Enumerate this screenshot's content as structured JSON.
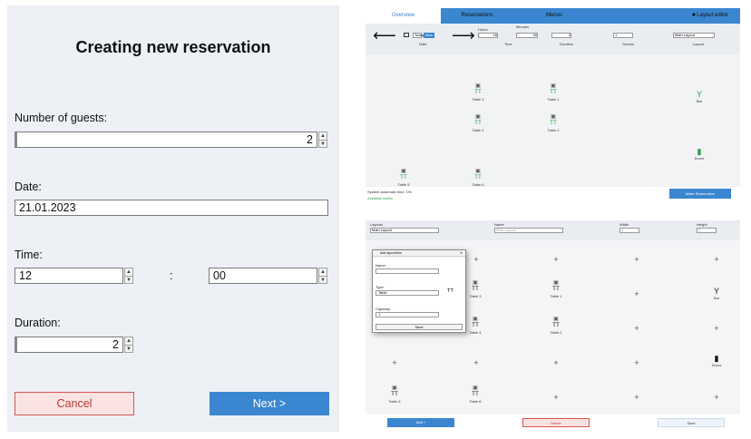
{
  "form": {
    "title": "Creating new reservation",
    "guests_label": "Number of guests:",
    "guests_value": "2",
    "date_label": "Date:",
    "date_value": "21.01.2023",
    "time_label": "Time:",
    "hours_value": "12",
    "time_separator": ":",
    "minutes_value": "00",
    "duration_label": "Duration:",
    "duration_value": "2",
    "cancel_label": "Cancel",
    "next_label": "Next >"
  },
  "overview": {
    "tabs": [
      "Overview",
      "Reservations",
      "Menus"
    ],
    "layout_editor_label": "Layout editor",
    "date_label": "Date",
    "today_label": "Today",
    "now_label": "Now",
    "hours_label": "Hours",
    "minutes_label": "Minutes",
    "hours_value": "16",
    "minutes_value": "30",
    "time_label": "Time",
    "duration_label": "Duration",
    "duration_value": "2",
    "guests_label": "Guests",
    "guests_value": "1",
    "layout_label": "Layout",
    "layout_value": "Main Layout",
    "tables": [
      {
        "name": "Table 3",
        "icon": "fork-knife-icon"
      },
      {
        "name": "Table 1",
        "icon": "fork-knife-icon"
      },
      {
        "name": "Bar",
        "icon": "cocktail-icon"
      },
      {
        "name": "Table 4",
        "icon": "fork-knife-icon"
      },
      {
        "name": "Table 2",
        "icon": "fork-knife-icon"
      },
      {
        "name": "Doors",
        "icon": "door-icon"
      },
      {
        "name": "Table 5",
        "icon": "fork-knife-icon"
      },
      {
        "name": "Table 6",
        "icon": "fork-knife-icon"
      }
    ],
    "status_line1": "System automatic time: ON",
    "status_line2": "Available tables",
    "make_reservation_label": "Make Reservation"
  },
  "editor": {
    "layouts_label": "Layouts",
    "layouts_value": "Main Layout",
    "name_label": "Name",
    "name_placeholder": "Main Layout",
    "width_label": "Width",
    "width_value": "5",
    "height_label": "Height",
    "height_value": "5",
    "plus": "+",
    "cells": [
      {
        "name": "Table 3",
        "icon": "fork-knife-icon"
      },
      {
        "name": "Table 1",
        "icon": "fork-knife-icon"
      },
      {
        "name": "Bar",
        "icon": "cocktail-icon"
      },
      {
        "name": "Table 4",
        "icon": "fork-knife-icon"
      },
      {
        "name": "Table 2",
        "icon": "fork-knife-icon"
      },
      {
        "name": "Doors",
        "icon": "door-icon"
      },
      {
        "name": "Table 5",
        "icon": "fork-knife-icon"
      },
      {
        "name": "Table 6",
        "icon": "fork-knife-icon"
      }
    ],
    "add_label": "Add +",
    "delete_label": "Delete",
    "save_label": "Save",
    "dialog": {
      "title": "Add layout item",
      "name_label": "Name:",
      "type_label": "Type:",
      "type_value": "Table",
      "capacity_label": "Capacity:",
      "capacity_value": "1",
      "save_label": "Save"
    }
  }
}
